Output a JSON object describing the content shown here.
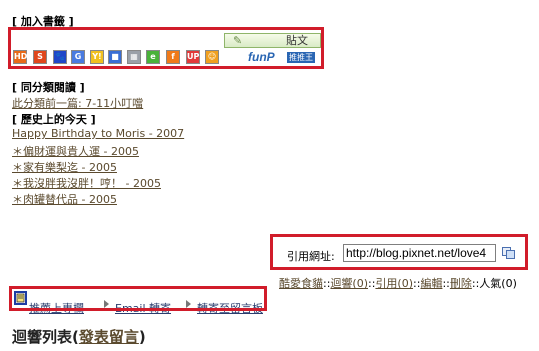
{
  "bookmarks": {
    "heading": "[ 加入書籤 ]",
    "post_button": "貼文",
    "funp_logo": "funP",
    "funp_tag": "推推王",
    "icons": [
      {
        "name": "hd-icon",
        "text": "HD",
        "color": "#e86a1a"
      },
      {
        "name": "bookmark-s-icon",
        "text": "S",
        "color": "#e0461c"
      },
      {
        "name": "paw-icon",
        "text": "🐾",
        "color": "#2046c8"
      },
      {
        "name": "google-icon",
        "text": "G",
        "color": "#4a7be0"
      },
      {
        "name": "yahoo-icon",
        "text": "Y!",
        "color": "#f0c020"
      },
      {
        "name": "delicious-icon",
        "text": "■",
        "color": "#3a6ed3"
      },
      {
        "name": "grid-icon",
        "text": "▦",
        "color": "#9aa0a8"
      },
      {
        "name": "hemi-icon",
        "text": "e",
        "color": "#4ab23a"
      },
      {
        "name": "facebook-icon",
        "text": "f",
        "color": "#f07a1a"
      },
      {
        "name": "up-icon",
        "text": "UP",
        "color": "#e23a3a"
      },
      {
        "name": "smile-icon",
        "text": "☺",
        "color": "#f0a020"
      }
    ]
  },
  "same_category": {
    "heading": "[ 同分類閱讀 ]",
    "prev_link": "此分類前一篇: 7-11小叮噹"
  },
  "history": {
    "heading": "[ 歷史上的今天 ]",
    "items": [
      "Happy Birthday to Moris - 2007",
      "＊偏財運與貴人運 - 2005",
      "＊家有樂梨迄 - 2005",
      "＊我沒胖我沒胖！哼！ - 2005",
      "＊肉罐替代品 - 2005"
    ]
  },
  "trackback": {
    "label": "引用網址:",
    "url": "http://blog.pixnet.net/love4"
  },
  "meta": {
    "author": "酷愛食貓",
    "sep": "::",
    "reply": "迴響(0)",
    "trackback": "引用(0)",
    "edit": "編輯",
    "delete": "刪除",
    "popularity": "人氣(0)"
  },
  "share": {
    "recommend": "推薦上專欄",
    "email": "Email 轉寄",
    "forward": "轉寄至留言板"
  },
  "comments": {
    "title": "迴響列表",
    "post_link": "發表留言"
  }
}
